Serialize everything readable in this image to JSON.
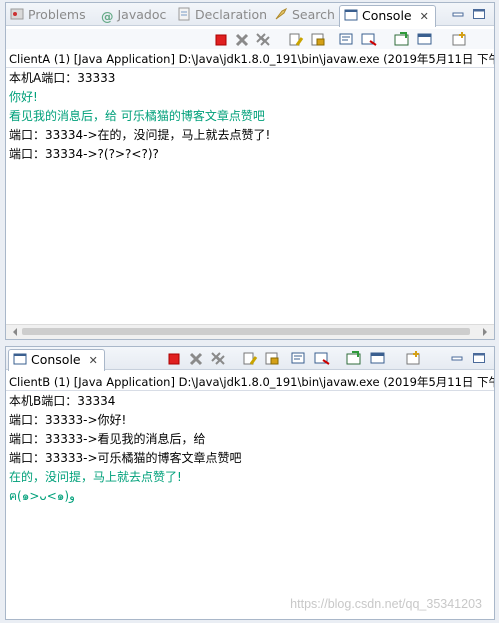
{
  "top_pane": {
    "tabs": [
      {
        "label": "Problems",
        "icon": "problems-icon",
        "active": false
      },
      {
        "label": "Javadoc",
        "icon": "javadoc-icon",
        "active": false
      },
      {
        "label": "Declaration",
        "icon": "declaration-icon",
        "active": false
      },
      {
        "label": "Search",
        "icon": "search-icon",
        "active": false
      },
      {
        "label": "Console",
        "icon": "console-icon",
        "active": true
      }
    ],
    "close_glyph": "✕",
    "process_line": "ClientA (1) [Java Application] D:\\Java\\jdk1.8.0_191\\bin\\javaw.exe (2019年5月11日 下午",
    "lines": [
      {
        "text": "本机A端口：33333",
        "input": false
      },
      {
        "text": "你好!",
        "input": true
      },
      {
        "text": "看见我的消息后，给 可乐橘猫的博客文章点赞吧",
        "input": true
      },
      {
        "text": "端口：33334->在的，没问提，马上就去点赞了!",
        "input": false
      },
      {
        "text": "端口：33334->?(?>?<?)?",
        "input": false
      }
    ]
  },
  "bottom_pane": {
    "tab": {
      "label": "Console",
      "icon": "console-icon"
    },
    "close_glyph": "✕",
    "process_line": "ClientB (1) [Java Application] D:\\Java\\jdk1.8.0_191\\bin\\javaw.exe (2019年5月11日 下午",
    "lines": [
      {
        "text": "本机B端口：33334",
        "input": false
      },
      {
        "text": "端口：33333->你好!",
        "input": false
      },
      {
        "text": "端口：33333->看见我的消息后，给",
        "input": false
      },
      {
        "text": "端口：33333->可乐橘猫的博客文章点赞吧",
        "input": false
      },
      {
        "text": "在的，没问提，马上就去点赞了!",
        "input": true
      },
      {
        "text": "ฅ(๑>ᴗ<๑)ﻭ",
        "input": true
      }
    ]
  },
  "watermark": "https://blog.csdn.net/qq_35341203",
  "colors": {
    "input_text": "#00a07a",
    "terminate_red": "#e02020"
  }
}
